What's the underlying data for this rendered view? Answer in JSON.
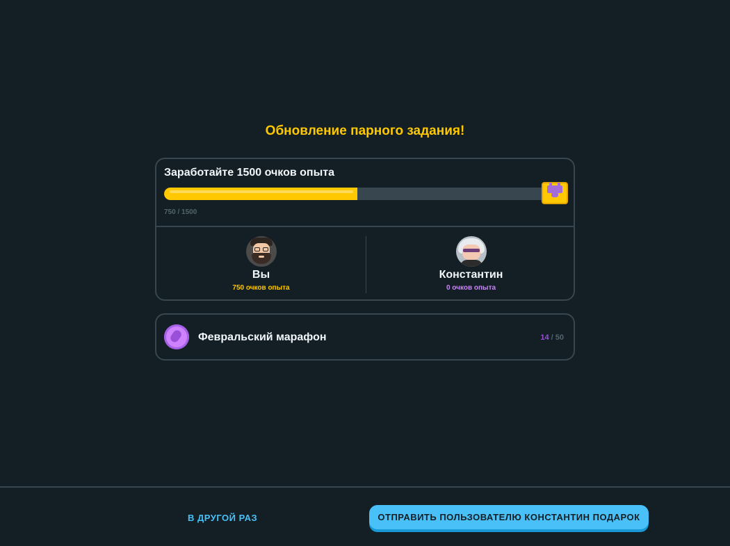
{
  "heading": "Обновление парного задания!",
  "quest": {
    "title": "Заработайте 1500 очков опыта",
    "progress_text": "750 / 1500",
    "progress_current": 750,
    "progress_total": 1500,
    "chest_icon": "chest-icon"
  },
  "players": [
    {
      "name": "Вы",
      "xp": "750 очков опыта",
      "xp_color": "#ffc800"
    },
    {
      "name": "Константин",
      "xp": "0 очков опыта",
      "xp_color": "#ce82ff"
    }
  ],
  "marathon": {
    "title": "Февральский марафон",
    "current": "14",
    "separator": " / ",
    "total": "50",
    "icon": "shoe-icon"
  },
  "footer": {
    "later_label": "В ДРУГОЙ РАЗ",
    "gift_label": "ОТПРАВИТЬ ПОЛЬЗОВАТЕЛЮ КОНСТАНТИН ПОДАРОК"
  },
  "colors": {
    "background": "#131f24",
    "accent_gold": "#ffc800",
    "accent_purple": "#ce82ff",
    "accent_blue": "#49c0f8",
    "border": "#37464f"
  }
}
